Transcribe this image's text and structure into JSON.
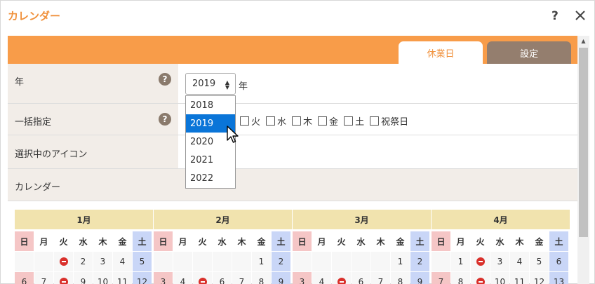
{
  "dialog": {
    "title": "カレンダー",
    "help_label": "?"
  },
  "tabs": [
    {
      "label": "休業日"
    },
    {
      "label": "設定"
    }
  ],
  "rows": {
    "year": {
      "label": "年",
      "selected": "2019",
      "suffix": "年"
    },
    "bulk": {
      "label": "一括指定"
    },
    "icon": {
      "label": "選択中のアイコン"
    },
    "calendar": {
      "label": "カレンダー"
    }
  },
  "help_icon_glyph": "?",
  "year_options": [
    "2018",
    "2019",
    "2020",
    "2021",
    "2022"
  ],
  "selected_year_index": 1,
  "weekday_checkboxes": [
    "火",
    "水",
    "木",
    "金",
    "土",
    "祝祭日"
  ],
  "accent_color": "#f89c49",
  "weekdays": [
    "日",
    "月",
    "火",
    "水",
    "木",
    "金",
    "土"
  ],
  "months": [
    {
      "label": "1月",
      "rows": [
        [
          "",
          "",
          "holiday-icon",
          "2",
          "3",
          "4",
          "5"
        ],
        [
          "6",
          "7",
          "holiday-icon",
          "9",
          "10",
          "11",
          "12"
        ]
      ]
    },
    {
      "label": "2月",
      "rows": [
        [
          "",
          "",
          "",
          "",
          "",
          "1",
          "2"
        ],
        [
          "3",
          "4",
          "holiday-icon",
          "6",
          "7",
          "8",
          "9"
        ]
      ]
    },
    {
      "label": "3月",
      "rows": [
        [
          "",
          "",
          "",
          "",
          "",
          "1",
          "2"
        ],
        [
          "3",
          "4",
          "holiday-icon",
          "6",
          "7",
          "8",
          "9"
        ]
      ]
    },
    {
      "label": "4月",
      "rows": [
        [
          "",
          "1",
          "holiday-icon",
          "3",
          "4",
          "5",
          "6"
        ],
        [
          "7",
          "8",
          "holiday-icon",
          "10",
          "11",
          "12",
          "13"
        ]
      ]
    }
  ]
}
